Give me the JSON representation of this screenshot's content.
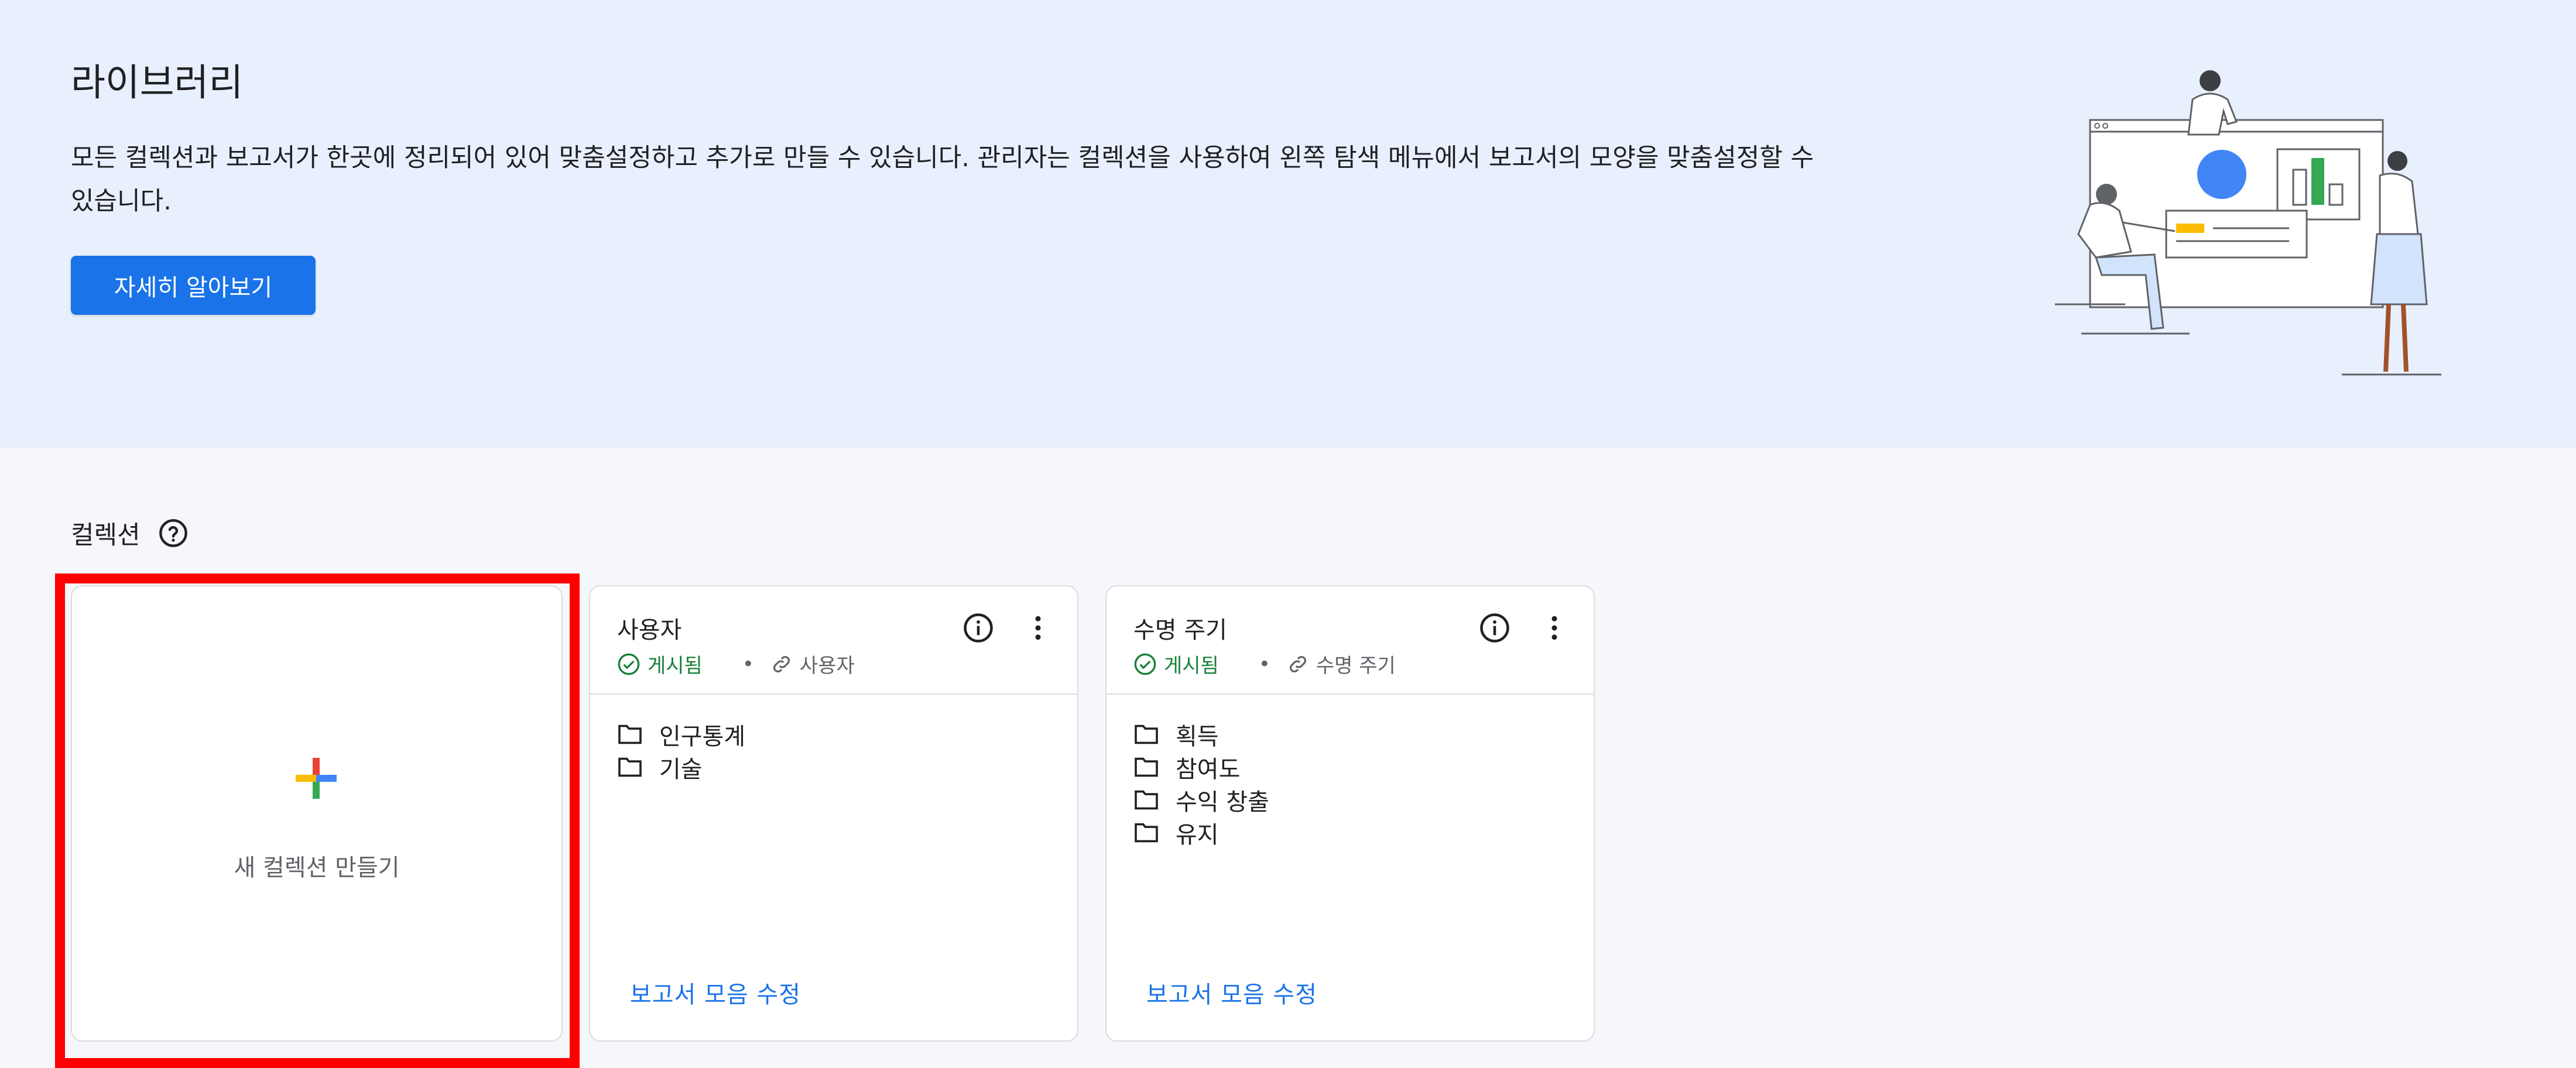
{
  "hero": {
    "title": "라이브러리",
    "description": "모든 컬렉션과 보고서가 한곳에 정리되어 있어 맞춤설정하고 추가로 만들 수 있습니다. 관리자는 컬렉션을 사용하여 왼쪽 탐색 메뉴에서 보고서의 모양을 맞춤설정할 수 있습니다.",
    "learn_more_label": "자세히 알아보기"
  },
  "collections": {
    "section_title": "컬렉션",
    "new_collection_label": "새 컬렉션 만들기",
    "cards": [
      {
        "title": "사용자",
        "status": "게시됨",
        "linked_group": "사용자",
        "folders": [
          "인구통계",
          "기술"
        ],
        "edit_label": "보고서 모음 수정"
      },
      {
        "title": "수명 주기",
        "status": "게시됨",
        "linked_group": "수명 주기",
        "folders": [
          "획득",
          "참여도",
          "수익 창출",
          "유지"
        ],
        "edit_label": "보고서 모음 수정"
      }
    ]
  },
  "colors": {
    "accent": "#1a73e8",
    "hero_bg": "#e9f0fd",
    "published_green": "#188038",
    "highlight_red": "#ff0000"
  }
}
